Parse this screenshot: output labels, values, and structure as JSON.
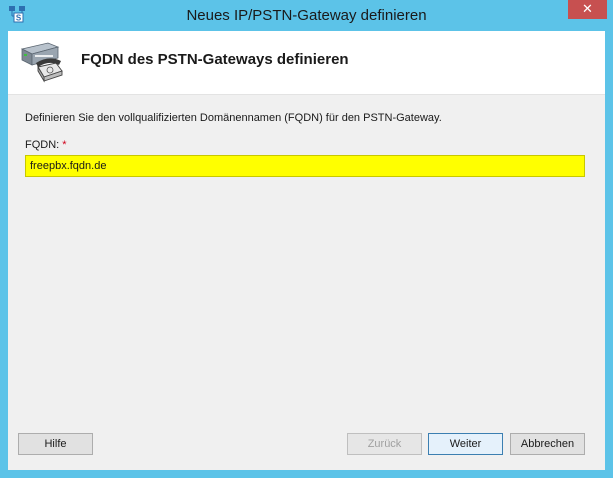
{
  "window": {
    "title": "Neues IP/PSTN-Gateway definieren",
    "close_glyph": "✕"
  },
  "header": {
    "title": "FQDN des PSTN-Gateways definieren",
    "icon": "pstn-gateway-phone-icon"
  },
  "form": {
    "description": "Definieren Sie den vollqualifizierten Domänennamen (FQDN) für den PSTN-Gateway.",
    "fqdn_label": "FQDN:",
    "required_marker": "*",
    "fqdn_value": "freepbx.fqdn.de",
    "fqdn_highlight": "#ffff00"
  },
  "buttons": {
    "help": "Hilfe",
    "back": "Zurück",
    "next": "Weiter",
    "cancel": "Abbrechen"
  },
  "colors": {
    "frame": "#5cc3e8",
    "close": "#c75050",
    "client": "#f0f0f0"
  }
}
